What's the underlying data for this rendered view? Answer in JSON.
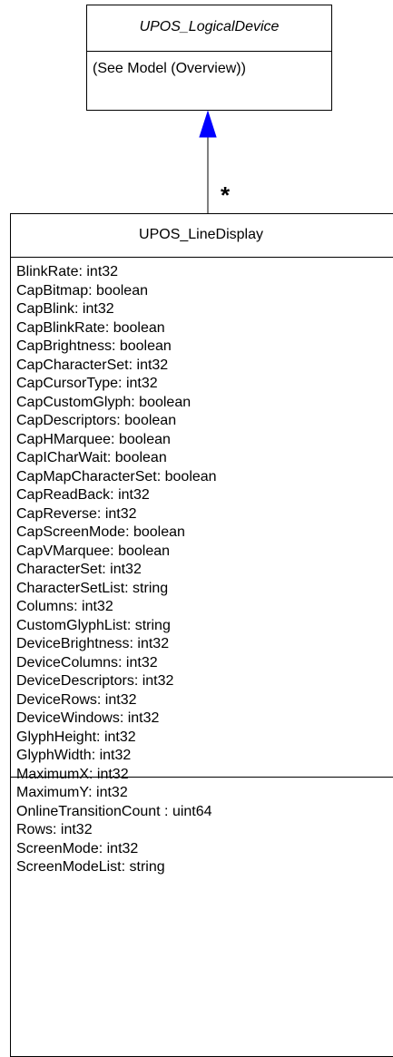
{
  "parent": {
    "name": "UPOS_LogicalDevice",
    "body": "(See Model (Overview))"
  },
  "association": {
    "multiplicity": "*",
    "arrow_color": "#0000ff",
    "line_color": "#000000"
  },
  "child": {
    "name": "UPOS_LineDisplay",
    "attributes": [
      "BlinkRate: int32",
      "CapBitmap: boolean",
      "CapBlink: int32",
      "CapBlinkRate: boolean",
      "CapBrightness: boolean",
      "CapCharacterSet: int32",
      "CapCursorType: int32",
      "CapCustomGlyph: boolean",
      "CapDescriptors: boolean",
      "CapHMarquee: boolean",
      "CapICharWait: boolean",
      "CapMapCharacterSet: boolean",
      "CapReadBack: int32",
      "CapReverse: int32",
      "CapScreenMode: boolean",
      "CapVMarquee: boolean",
      "CharacterSet: int32",
      "CharacterSetList: string",
      "Columns: int32",
      "CustomGlyphList: string",
      "DeviceBrightness: int32",
      "DeviceColumns: int32",
      "DeviceDescriptors: int32",
      "DeviceRows: int32",
      "DeviceWindows: int32",
      "GlyphHeight: int32",
      "GlyphWidth: int32",
      "MaximumX: int32",
      "MaximumY: int32",
      "OnlineTransitionCount : uint64",
      "Rows: int32",
      "ScreenMode: int32",
      "ScreenModeList: string"
    ]
  }
}
